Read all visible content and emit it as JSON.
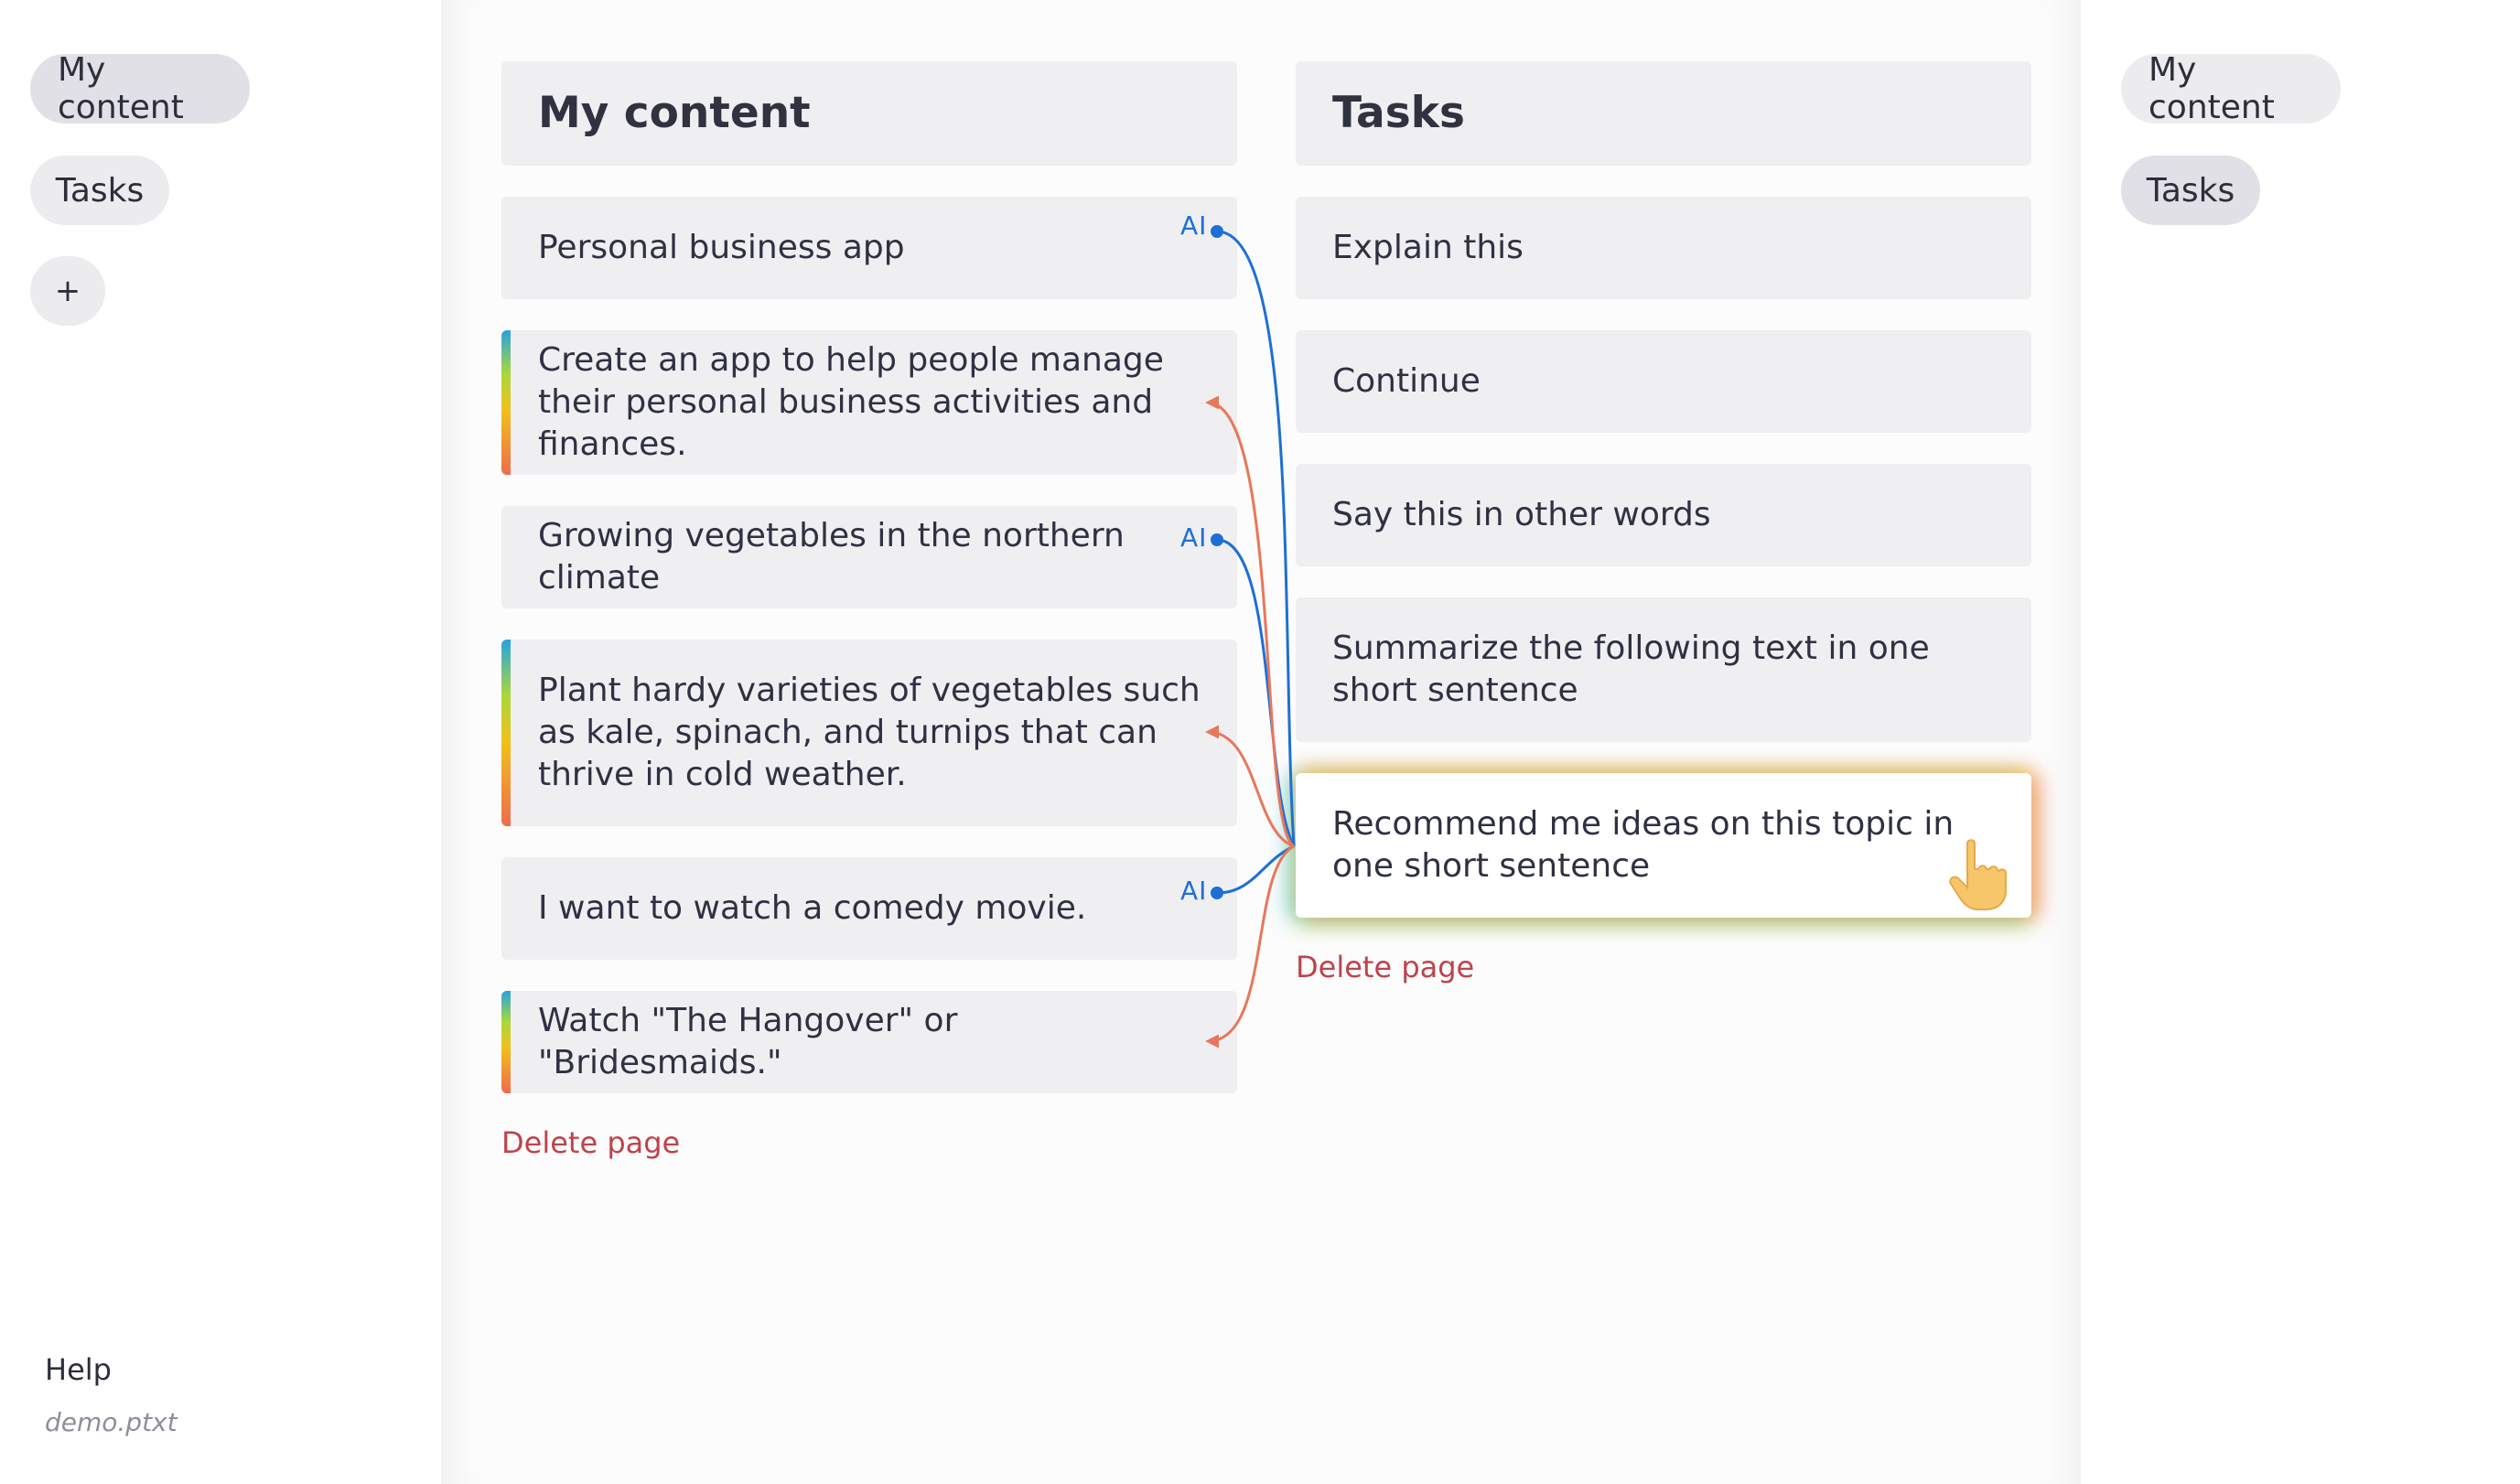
{
  "left_sidebar": {
    "nav": [
      {
        "label": "My content",
        "active": true
      },
      {
        "label": "Tasks",
        "active": false
      }
    ],
    "add_label": "+",
    "help_label": "Help",
    "filename": "demo.ptxt"
  },
  "right_sidebar": {
    "nav": [
      {
        "label": "My content",
        "active": false
      },
      {
        "label": "Tasks",
        "active": true
      }
    ]
  },
  "content_page": {
    "title": "My content",
    "items": [
      {
        "text": "Personal business app",
        "type": "prompt",
        "ai_label": "AI"
      },
      {
        "text": "Create an app to help people manage their personal business activities and finances.",
        "type": "response"
      },
      {
        "text": "Growing vegetables in the northern climate",
        "type": "prompt",
        "ai_label": "AI"
      },
      {
        "text": "Plant hardy varieties of vegetables such as kale, spinach, and turnips that can thrive in cold weather.",
        "type": "response"
      },
      {
        "text": "I want to watch a comedy movie.",
        "type": "prompt",
        "ai_label": "AI"
      },
      {
        "text": "Watch \"The Hangover\" or \"Bridesmaids.\"",
        "type": "response"
      }
    ],
    "delete_label": "Delete page"
  },
  "tasks_page": {
    "title": "Tasks",
    "items": [
      {
        "text": "Explain this"
      },
      {
        "text": "Continue"
      },
      {
        "text": "Say this in other words"
      },
      {
        "text": "Summarize the following text in one short sentence"
      },
      {
        "text": "Recommend me ideas on this topic in one short sentence",
        "selected": true
      }
    ],
    "delete_label": "Delete page"
  },
  "colors": {
    "ai_link": "#1d6fd6",
    "response_link": "#e8775a",
    "delete": "#c0424a"
  },
  "icons": {
    "cursor": "pointing-hand-icon"
  }
}
